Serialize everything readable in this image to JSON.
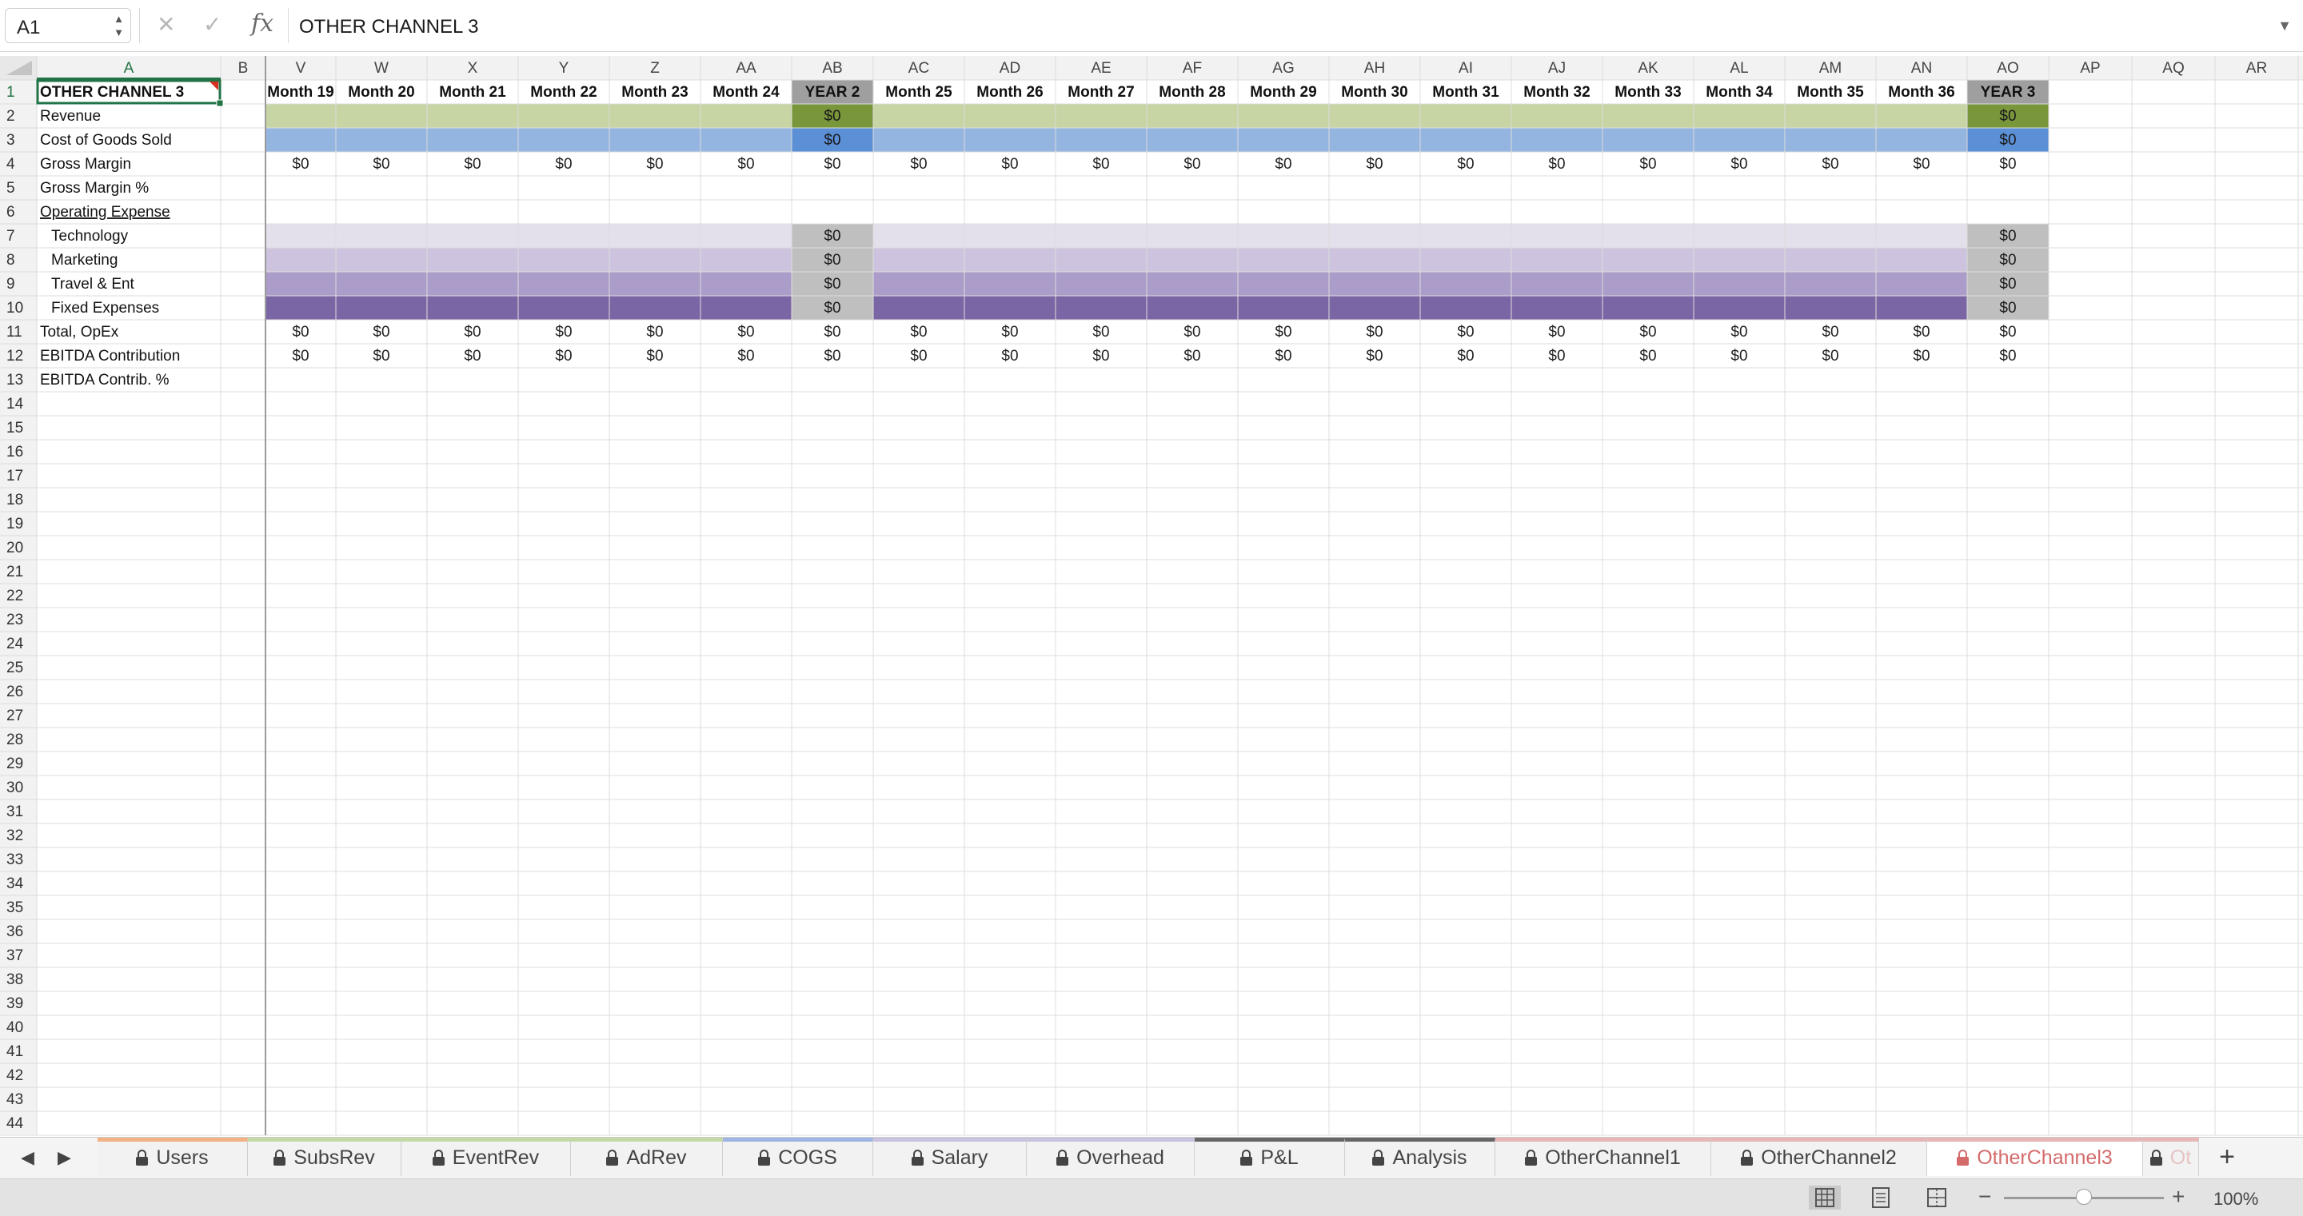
{
  "formula_bar": {
    "name_box": "A1",
    "fx_label": "fx",
    "content": "OTHER CHANNEL 3"
  },
  "columns": [
    "A",
    "B",
    "V",
    "W",
    "X",
    "Y",
    "Z",
    "AA",
    "AB",
    "AC",
    "AD",
    "AE",
    "AF",
    "AG",
    "AH",
    "AI",
    "AJ",
    "AK",
    "AL",
    "AM",
    "AN",
    "AO",
    "AP",
    "AQ",
    "AR"
  ],
  "header_row": [
    "OTHER CHANNEL 3",
    "",
    "Month 19",
    "Month 20",
    "Month 21",
    "Month 22",
    "Month 23",
    "Month 24",
    "YEAR 2",
    "Month 25",
    "Month 26",
    "Month 27",
    "Month 28",
    "Month 29",
    "Month 30",
    "Month 31",
    "Month 32",
    "Month 33",
    "Month 34",
    "Month 35",
    "Month 36",
    "YEAR 3",
    "",
    "",
    ""
  ],
  "row_labels": [
    "Revenue",
    "Cost of Goods Sold",
    "Gross Margin",
    "Gross Margin %",
    "Operating Expense",
    "  Technology",
    "  Marketing",
    "  Travel & Ent",
    "  Fixed Expenses",
    "Total, OpEx",
    "EBITDA Contribution",
    "EBITDA Contrib. %"
  ],
  "underlined_labels": [
    "Operating Expense"
  ],
  "zero_value": "$0",
  "rows_with_all_values": [
    4,
    11,
    12
  ],
  "rows_with_year_values": [
    2,
    3,
    7,
    8,
    9,
    10
  ],
  "row_count": 44,
  "band_colors": {
    "2": {
      "fill": "#c6d5a3",
      "year": "#79963b"
    },
    "3": {
      "fill": "#95b5e1",
      "year": "#5b8fd6"
    },
    "7": {
      "fill": "#e3dfeb",
      "year": "#bfbfbf"
    },
    "8": {
      "fill": "#cdc3de",
      "year": "#bfbfbf"
    },
    "9": {
      "fill": "#ab9cc9",
      "year": "#bfbfbf"
    },
    "10": {
      "fill": "#7b66a5",
      "year": "#bfbfbf"
    }
  },
  "year_header_color": "#9f9f9f",
  "sheet_tabs": [
    {
      "label": "Users",
      "color": "#f4b183",
      "locked": true,
      "active": false
    },
    {
      "label": "SubsRev",
      "color": "#c5d9a4",
      "locked": true,
      "active": false
    },
    {
      "label": "EventRev",
      "color": "#c5d9a4",
      "locked": true,
      "active": false
    },
    {
      "label": "AdRev",
      "color": "#c5d9a4",
      "locked": true,
      "active": false
    },
    {
      "label": "COGS",
      "color": "#9db6e4",
      "locked": true,
      "active": false
    },
    {
      "label": "Salary",
      "color": "#c9c2de",
      "locked": true,
      "active": false
    },
    {
      "label": "Overhead",
      "color": "#c9c2de",
      "locked": true,
      "active": false
    },
    {
      "label": "P&L",
      "color": "#666666",
      "locked": true,
      "active": false
    },
    {
      "label": "Analysis",
      "color": "#666666",
      "locked": true,
      "active": false
    },
    {
      "label": "OtherChannel1",
      "color": "#e7b6b6",
      "locked": true,
      "active": false
    },
    {
      "label": "OtherChannel2",
      "color": "#e7b6b6",
      "locked": true,
      "active": false
    },
    {
      "label": "OtherChannel3",
      "color": "#e7b6b6",
      "locked": true,
      "active": true
    },
    {
      "label": "Ot",
      "color": "#e7b6b6",
      "locked": true,
      "active": false
    }
  ],
  "add_sheet_label": "+",
  "status_bar": {
    "zoom": "100%",
    "zoom_level_percent": 100,
    "zoom_minus": "−",
    "zoom_plus": "+"
  }
}
